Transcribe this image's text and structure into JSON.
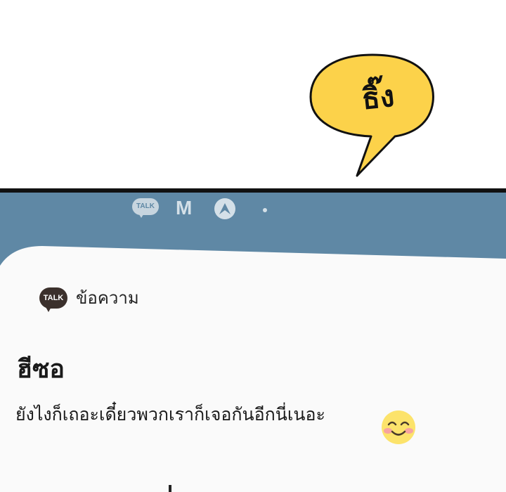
{
  "sfx": {
    "text": "ธิ๊ง"
  },
  "status_bar": {
    "icons": [
      "kakaotalk-icon",
      "gmail-icon",
      "navigation-icon",
      "dot-icon"
    ],
    "talk_label": "TALK",
    "m_label": "M"
  },
  "notification": {
    "app_icon": "kakaotalk-icon",
    "app_icon_label": "TALK",
    "app_name": "ข้อความ",
    "sender": "ฮีซอ",
    "message": "ยังไงก็เถอะเดี๋ยวพวกเราก็เจอกันอีกนี่เนอะ",
    "emoji": "smiling-face-icon"
  },
  "colors": {
    "bubble": "#fcd24a",
    "status_bar": "#5f88a5",
    "card": "#fafafa",
    "talk_badge": "#3b302c"
  }
}
